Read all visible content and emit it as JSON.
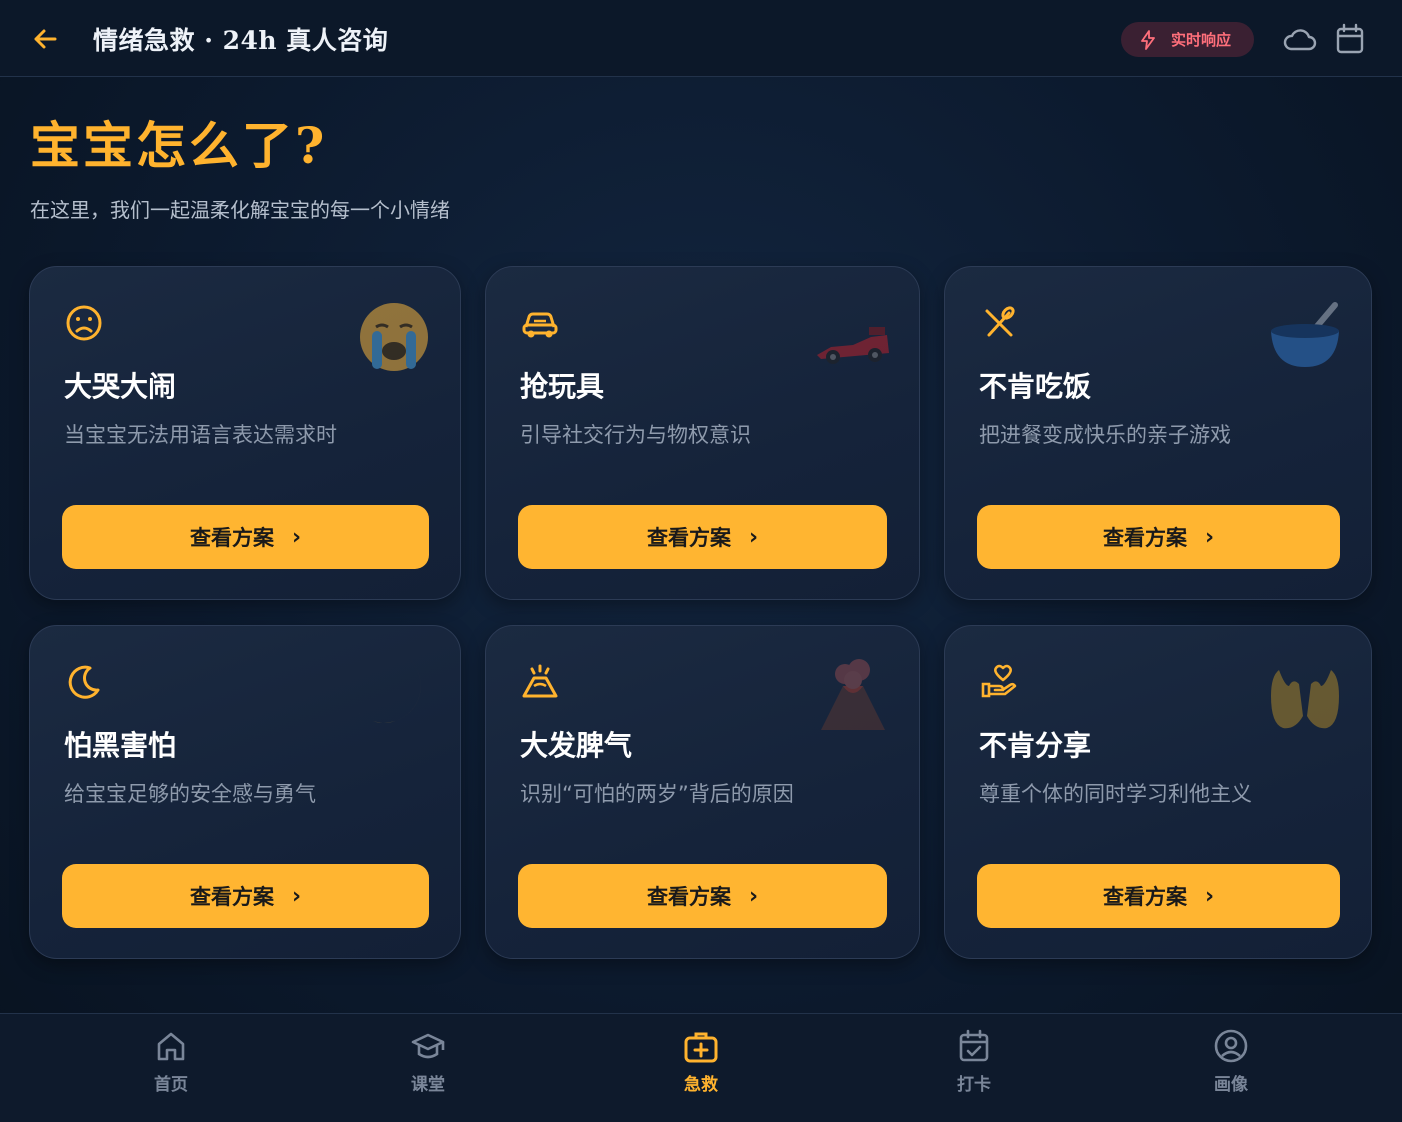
{
  "header": {
    "title": "情绪急救 · 24h 真人咨询",
    "live_badge": "实时响应"
  },
  "hero": {
    "title": "宝宝怎么了?",
    "subtitle": "在这里，我们一起温柔化解宝宝的每一个小情绪"
  },
  "cards": [
    {
      "title": "大哭大闹",
      "desc": "当宝宝无法用语言表达需求时",
      "cta": "查看方案",
      "icon": "sad-face-icon",
      "emoji": "crying-face-emoji"
    },
    {
      "title": "抢玩具",
      "desc": "引导社交行为与物权意识",
      "cta": "查看方案",
      "icon": "toy-car-icon",
      "emoji": "race-car-emoji"
    },
    {
      "title": "不肯吃饭",
      "desc": "把进餐变成快乐的亲子游戏",
      "cta": "查看方案",
      "icon": "utensils-icon",
      "emoji": "bowl-emoji"
    },
    {
      "title": "怕黑害怕",
      "desc": "给宝宝足够的安全感与勇气",
      "cta": "查看方案",
      "icon": "moon-icon",
      "emoji": "crescent-moon-emoji"
    },
    {
      "title": "大发脾气",
      "desc": "识别“可怕的两岁”背后的原因",
      "cta": "查看方案",
      "icon": "volcano-icon",
      "emoji": "volcano-emoji"
    },
    {
      "title": "不肯分享",
      "desc": "尊重个体的同时学习利他主义",
      "cta": "查看方案",
      "icon": "hand-heart-icon",
      "emoji": "open-hands-emoji"
    }
  ],
  "nav": [
    {
      "label": "首页",
      "icon": "home-icon",
      "active": false
    },
    {
      "label": "课堂",
      "icon": "graduation-cap-icon",
      "active": false
    },
    {
      "label": "急救",
      "icon": "first-aid-kit-icon",
      "active": true
    },
    {
      "label": "打卡",
      "icon": "calendar-check-icon",
      "active": false
    },
    {
      "label": "画像",
      "icon": "user-circle-icon",
      "active": false
    }
  ],
  "colors": {
    "accent": "#ffb32e",
    "button": "#ffb531",
    "badge_text": "#ff6f7b",
    "background": "#0c1a2e"
  }
}
